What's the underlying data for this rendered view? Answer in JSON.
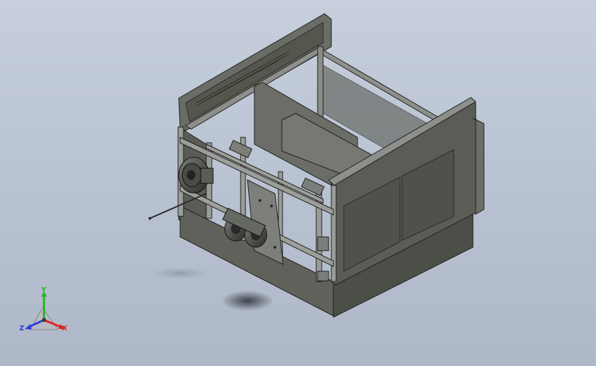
{
  "viewport": {
    "background_top": "#c7cfdc",
    "background_bottom": "#aeb8c8",
    "model_colors": {
      "panel_dark": "#4d4f4a",
      "panel_mid": "#5e605a",
      "panel_light": "#6c6e67",
      "frame": "#8a8c88",
      "edge": "#1e1f1d"
    }
  },
  "triad": {
    "x_label": "X",
    "y_label": "Y",
    "z_label": "Z",
    "x_color": "#e02020",
    "y_color": "#22b422",
    "z_color": "#2d3fd8"
  }
}
